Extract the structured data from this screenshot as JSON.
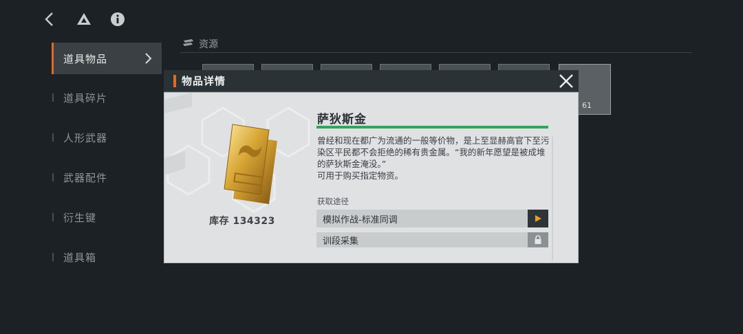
{
  "top_icons": [
    "back-icon",
    "drive-icon",
    "info-icon"
  ],
  "sidebar": {
    "items": [
      {
        "label": "道具物品",
        "active": true
      },
      {
        "label": "道具碎片",
        "active": false
      },
      {
        "label": "人形武器",
        "active": false
      },
      {
        "label": "武器配件",
        "active": false
      },
      {
        "label": "衍生键",
        "active": false
      },
      {
        "label": "道具箱",
        "active": false
      }
    ]
  },
  "resources": {
    "header": "资源",
    "tile_count_suffix": "61"
  },
  "modal": {
    "title": "物品详情",
    "item_name": "萨狄斯金",
    "description": "曾经和现在都广为流通的一般等价物，是上至显赫高官下至污染区平民都不会拒绝的稀有贵金属。“我的新年愿望是被成堆的萨狄斯金淹没。”\n可用于购买指定物资。",
    "stock_label": "库存 134323",
    "obtain_label": "获取途径",
    "routes": [
      {
        "label": "模拟作战-标准同调",
        "state": "play"
      },
      {
        "label": "训段采集",
        "state": "locked"
      }
    ],
    "accent_color": "#e06a2a",
    "underline_color": "#37a35a"
  }
}
